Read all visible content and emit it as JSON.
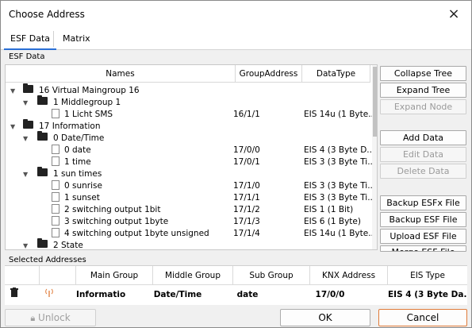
{
  "window": {
    "title": "Choose Address",
    "close_icon": "×"
  },
  "tabs": [
    {
      "label": "ESF Data"
    },
    {
      "label": "Matrix"
    }
  ],
  "esf_group_label": "ESF Data",
  "tree": {
    "headers": {
      "names": "Names",
      "group_address": "GroupAddress",
      "data_type": "DataType"
    },
    "rows": [
      {
        "label": "16 Virtual Maingroup 16",
        "ga": "",
        "dt": ""
      },
      {
        "label": "1 Middlegroup 1",
        "ga": "",
        "dt": ""
      },
      {
        "label": "1 Licht  SMS",
        "ga": "16/1/1",
        "dt": "EIS 14u (1 Byte..."
      },
      {
        "label": "17 Information",
        "ga": "",
        "dt": ""
      },
      {
        "label": "0 Date/Time",
        "ga": "",
        "dt": ""
      },
      {
        "label": "0 date",
        "ga": "17/0/0",
        "dt": "EIS 4 (3 Byte D..."
      },
      {
        "label": "1 time",
        "ga": "17/0/1",
        "dt": "EIS 3 (3 Byte Ti..."
      },
      {
        "label": "1 sun times",
        "ga": "",
        "dt": ""
      },
      {
        "label": "0 sunrise",
        "ga": "17/1/0",
        "dt": "EIS 3 (3 Byte Ti..."
      },
      {
        "label": "1 sunset",
        "ga": "17/1/1",
        "dt": "EIS 3 (3 Byte Ti..."
      },
      {
        "label": "2 switching output 1bit",
        "ga": "17/1/2",
        "dt": "EIS 1 (1 Bit)"
      },
      {
        "label": "3 switching output 1byte",
        "ga": "17/1/3",
        "dt": "EIS 6 (1 Byte)"
      },
      {
        "label": "4 switching output 1byte unsigned",
        "ga": "17/1/4",
        "dt": "EIS 14u (1 Byte..."
      },
      {
        "label": "2 State",
        "ga": "",
        "dt": ""
      }
    ]
  },
  "buttons": {
    "collapse_tree": "Collapse Tree",
    "expand_tree": "Expand Tree",
    "expand_node": "Expand Node",
    "add_data": "Add Data",
    "edit_data": "Edit Data",
    "delete_data": "Delete Data",
    "backup_esfx": "Backup ESFx File",
    "backup_esf": "Backup ESF File",
    "upload_esf": "Upload ESF File",
    "more": "Merge ESF File"
  },
  "selected": {
    "label": "Selected Addresses",
    "headers": {
      "main": "Main Group",
      "middle": "Middle Group",
      "sub": "Sub Group",
      "knx": "KNX Address",
      "eis": "EIS Type"
    },
    "row": {
      "main": "Information",
      "middle": "Date/Time",
      "sub": "date",
      "knx": "17/0/0",
      "eis": "EIS 4 (3 Byte Da..."
    }
  },
  "footer": {
    "unlock": "Unlock",
    "ok": "OK",
    "cancel": "Cancel"
  },
  "colors": {
    "accent": "#2a6fd6",
    "cancel_border": "#e07b39"
  }
}
